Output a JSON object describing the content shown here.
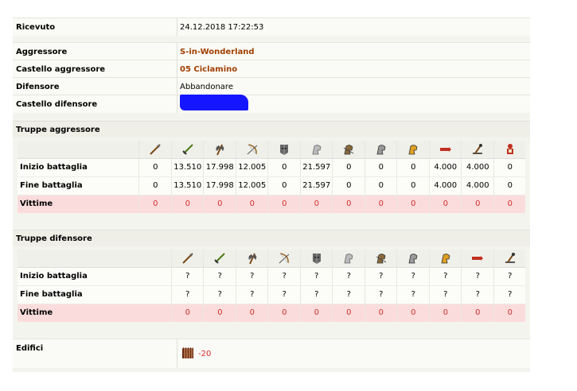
{
  "report": {
    "received_label": "Ricevuto",
    "received_value": "24.12.2018 17:22:53",
    "attacker_label": "Aggressore",
    "attacker_value": "S-in-Wonderland",
    "attacker_castle_label": "Castello aggressore",
    "attacker_castle_value": "05 Ciclamino",
    "defender_label": "Difensore",
    "defender_value": "Abbandonare",
    "defender_castle_label": "Castello difensore"
  },
  "colors": {
    "link": "#a04000",
    "loss_bg": "#fbdcdc",
    "loss_text": "#d03030",
    "redaction": "#1515ff"
  },
  "attacker_troops": {
    "title": "Truppe aggressore",
    "units": [
      "spearman-icon",
      "swordsman-icon",
      "axeman-icon",
      "archer-icon",
      "heavy-knight-helmet-icon",
      "scout-rider-icon",
      "light-cavalry-icon",
      "mounted-archer-icon",
      "heavy-cavalry-icon",
      "ram-icon",
      "catapult-icon",
      "paladin-icon"
    ],
    "rows": [
      {
        "label": "Inizio battaglia",
        "values": [
          "0",
          "13.510",
          "17.998",
          "12.005",
          "0",
          "21.597",
          "0",
          "0",
          "0",
          "4.000",
          "4.000",
          "0"
        ]
      },
      {
        "label": "Fine battaglia",
        "values": [
          "0",
          "13.510",
          "17.998",
          "12.005",
          "0",
          "21.597",
          "0",
          "0",
          "0",
          "4.000",
          "4.000",
          "0"
        ]
      },
      {
        "label": "Vittime",
        "values": [
          "0",
          "0",
          "0",
          "0",
          "0",
          "0",
          "0",
          "0",
          "0",
          "0",
          "0",
          "0"
        ]
      }
    ]
  },
  "defender_troops": {
    "title": "Truppe difensore",
    "units": [
      "spearman-icon",
      "swordsman-icon",
      "axeman-icon",
      "archer-icon",
      "heavy-knight-helmet-icon",
      "scout-rider-icon",
      "light-cavalry-icon",
      "mounted-archer-icon",
      "heavy-cavalry-icon",
      "ram-icon",
      "catapult-icon"
    ],
    "rows": [
      {
        "label": "Inizio battaglia",
        "values": [
          "?",
          "?",
          "?",
          "?",
          "?",
          "?",
          "?",
          "?",
          "?",
          "?",
          "?"
        ]
      },
      {
        "label": "Fine battaglia",
        "values": [
          "?",
          "?",
          "?",
          "?",
          "?",
          "?",
          "?",
          "?",
          "?",
          "?",
          "?"
        ]
      },
      {
        "label": "Vittime",
        "values": [
          "0",
          "0",
          "0",
          "0",
          "0",
          "0",
          "0",
          "0",
          "0",
          "0",
          "0"
        ]
      }
    ]
  },
  "buildings": {
    "label": "Edifici",
    "icon": "palisade-wall-icon",
    "change": "-20"
  }
}
